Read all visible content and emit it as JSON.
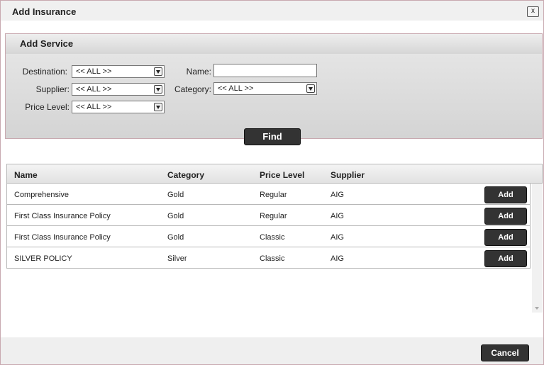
{
  "dialog": {
    "title": "Add Insurance",
    "close_label": "x"
  },
  "search": {
    "title": "Add Service",
    "destination_label": "Destination:",
    "destination_value": "<< ALL >>",
    "supplier_label": "Supplier:",
    "supplier_value": "<< ALL >>",
    "price_level_label": "Price Level:",
    "price_level_value": "<< ALL >>",
    "name_label": "Name:",
    "name_value": "",
    "category_label": "Category:",
    "category_value": "<< ALL >>",
    "find_label": "Find"
  },
  "table": {
    "columns": [
      "Name",
      "Category",
      "Price Level",
      "Supplier"
    ],
    "add_label": "Add",
    "rows": [
      {
        "name": "Comprehensive",
        "category": "Gold",
        "price_level": "Regular",
        "supplier": "AIG"
      },
      {
        "name": "First Class Insurance Policy",
        "category": "Gold",
        "price_level": "Regular",
        "supplier": "AIG"
      },
      {
        "name": "First Class Insurance Policy",
        "category": "Gold",
        "price_level": "Classic",
        "supplier": "AIG"
      },
      {
        "name": "SILVER POLICY",
        "category": "Silver",
        "price_level": "Classic",
        "supplier": "AIG"
      }
    ]
  },
  "footer": {
    "cancel_label": "Cancel"
  }
}
